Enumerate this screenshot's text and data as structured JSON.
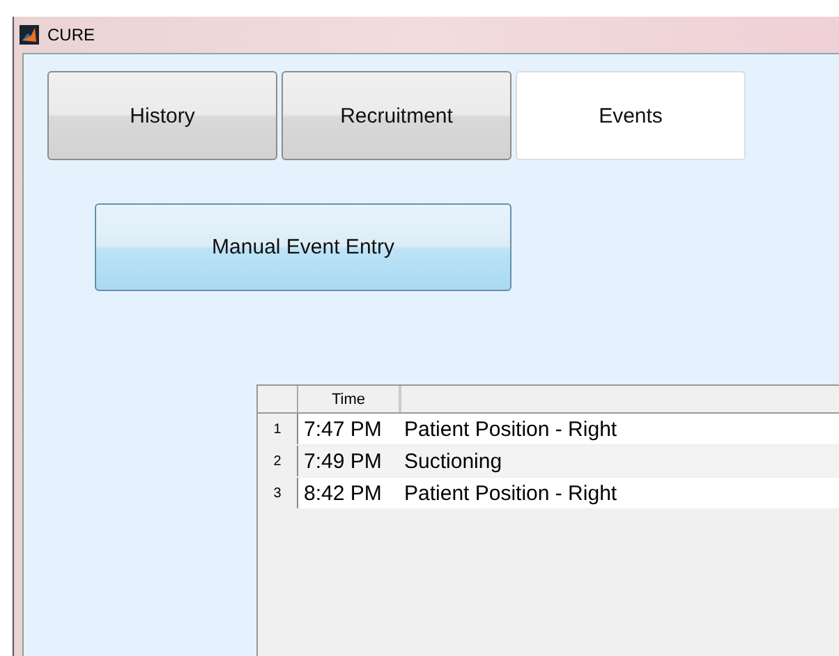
{
  "window": {
    "title": "CURE"
  },
  "tabs": [
    {
      "label": "History",
      "selected": false
    },
    {
      "label": "Recruitment",
      "selected": false
    },
    {
      "label": "Events",
      "selected": true
    }
  ],
  "action_button": {
    "label": "Manual Event Entry"
  },
  "table": {
    "columns": [
      "Time"
    ],
    "rows": [
      {
        "number": "1",
        "time": "7:47 PM",
        "event": "Patient Position - Right"
      },
      {
        "number": "2",
        "time": "7:49 PM",
        "event": "Suctioning"
      },
      {
        "number": "3",
        "time": "8:42 PM",
        "event": "Patient Position - Right"
      }
    ]
  }
}
